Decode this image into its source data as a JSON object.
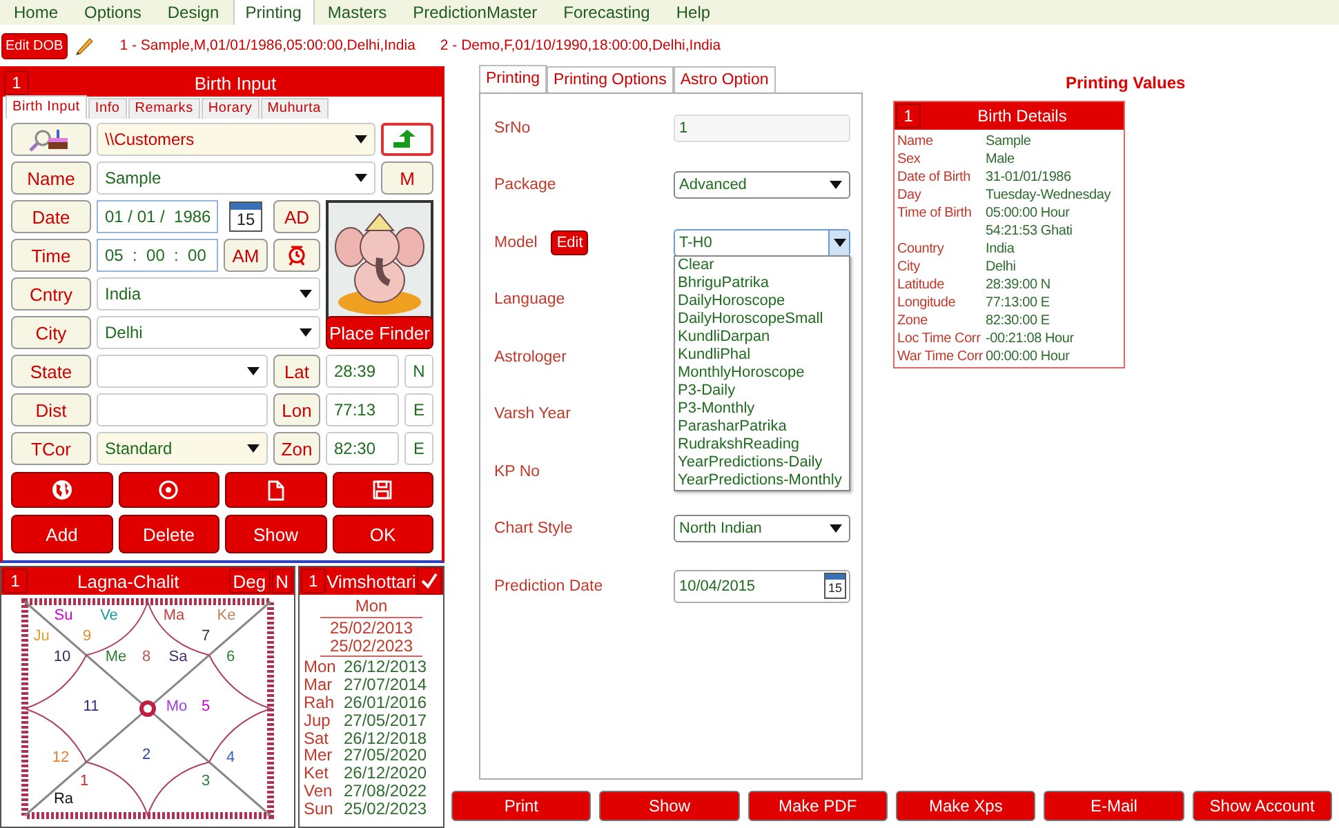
{
  "menu": [
    {
      "label": "Home",
      "selected": false
    },
    {
      "label": "Options",
      "selected": false
    },
    {
      "label": "Design",
      "selected": false
    },
    {
      "label": "Printing",
      "selected": true
    },
    {
      "label": "Masters",
      "selected": false
    },
    {
      "label": "PredictionMaster",
      "selected": false
    },
    {
      "label": "Forecasting",
      "selected": false
    },
    {
      "label": "Help",
      "selected": false
    }
  ],
  "edit_dob_button": "Edit DOB",
  "recent_records": [
    "1 - Sample,M,01/01/1986,05:00:00,Delhi,India",
    "2 - Demo,F,01/10/1990,18:00:00,Delhi,India"
  ],
  "birth_input": {
    "number": "1",
    "title": "Birth Input",
    "tabs": [
      {
        "label": "Birth Input",
        "selected": true
      },
      {
        "label": "Info",
        "selected": false
      },
      {
        "label": "Remarks",
        "selected": false
      },
      {
        "label": "Horary",
        "selected": false
      },
      {
        "label": "Muhurta",
        "selected": false
      }
    ],
    "folder": "\\\\Customers",
    "name_label": "Name",
    "name": "Sample",
    "sex": "M",
    "date_label": "Date",
    "date": "01 / 01 /  1986",
    "calendar_day": "15",
    "era": "AD",
    "time_label": "Time",
    "time": "05  :  00  :  00",
    "meridiem": "AM",
    "country_label": "Cntry",
    "country": "India",
    "city_label": "City",
    "city": "Delhi",
    "place_finder": "Place Finder",
    "state_label": "State",
    "lat_label": "Lat",
    "lat": "28:39",
    "lat_dir": "N",
    "dist_label": "Dist",
    "lon_label": "Lon",
    "lon": "77:13",
    "lon_dir": "E",
    "tcor_label": "TCor",
    "tcor": "Standard",
    "zon_label": "Zon",
    "zon": "82:30",
    "zon_dir": "E",
    "actions": [
      "Add",
      "Delete",
      "Show",
      "OK"
    ]
  },
  "lagna_chart": {
    "number": "1",
    "title": "Lagna-Chalit",
    "deg_button": "Deg",
    "n_button": "N",
    "houses": [
      {
        "sign": "9",
        "color": "#e09030",
        "planets": [
          {
            "name": "Su",
            "color": "#cc00cc"
          },
          {
            "name": "Ve",
            "color": "#1a9a9a"
          }
        ]
      },
      {
        "sign": "7",
        "color": "#333333",
        "planets": [
          {
            "name": "Ma",
            "color": "#c04040"
          },
          {
            "name": "Ke",
            "color": "#c08060"
          }
        ]
      },
      {
        "sign": "10",
        "color": "#303060",
        "planets": [
          {
            "name": "Ju",
            "color": "#e0a030"
          }
        ]
      },
      {
        "sign": "8",
        "color": "#c0504d",
        "planets": [
          {
            "name": "Me",
            "color": "#2e7d32"
          },
          {
            "name": "Sa",
            "color": "#4a2a6a"
          }
        ]
      },
      {
        "sign": "6",
        "color": "#2e7d32"
      },
      {
        "sign": "11",
        "color": "#303080"
      },
      {
        "sign": "5",
        "color": "#cc00cc",
        "planets": [
          {
            "name": "Mo",
            "color": "#a040e0"
          }
        ]
      },
      {
        "sign": "12",
        "color": "#e08030"
      },
      {
        "sign": "2",
        "color": "#3040a0"
      },
      {
        "sign": "4",
        "color": "#3060c0"
      },
      {
        "sign": "1",
        "color": "#c03030",
        "planets": [
          {
            "name": "Ra",
            "color": "#111111"
          }
        ]
      },
      {
        "sign": "3",
        "color": "#2e7d32"
      }
    ]
  },
  "vimshottari": {
    "number": "1",
    "title": "Vimshottari",
    "current_lord": "Mon",
    "start": "25/02/2013",
    "end": "25/02/2023",
    "periods": [
      {
        "lord": "Mon",
        "date": "26/12/2013"
      },
      {
        "lord": "Mar",
        "date": "27/07/2014"
      },
      {
        "lord": "Rah",
        "date": "26/01/2016"
      },
      {
        "lord": "Jup",
        "date": "27/05/2017"
      },
      {
        "lord": "Sat",
        "date": "26/12/2018"
      },
      {
        "lord": "Mer",
        "date": "27/05/2020"
      },
      {
        "lord": "Ket",
        "date": "26/12/2020"
      },
      {
        "lord": "Ven",
        "date": "27/08/2022"
      },
      {
        "lord": "Sun",
        "date": "25/02/2023"
      }
    ]
  },
  "printing_form": {
    "tabs": [
      {
        "label": "Printing",
        "selected": true
      },
      {
        "label": "Printing Options",
        "selected": false
      },
      {
        "label": "Astro Option",
        "selected": false
      }
    ],
    "fields": [
      {
        "label": "SrNo",
        "kind": "text",
        "value": "1"
      },
      {
        "label": "Package",
        "kind": "select",
        "value": "Advanced"
      },
      {
        "label": "Model",
        "kind": "select",
        "value": "T-H0",
        "edit_button": "Edit",
        "expanded": true,
        "options": [
          "Clear",
          "BhriguPatrika",
          "DailyHoroscope",
          "DailyHoroscopeSmall",
          "KundliDarpan",
          "KundliPhal",
          "MonthlyHoroscope",
          "P3-Daily",
          "P3-Monthly",
          "ParasharPatrika",
          "RudrakshReading",
          "YearPredictions-Daily",
          "YearPredictions-Monthly"
        ]
      },
      {
        "label": "Language",
        "kind": "covered"
      },
      {
        "label": "Astrologer",
        "kind": "covered"
      },
      {
        "label": "Varsh Year",
        "kind": "covered"
      },
      {
        "label": "KP No",
        "kind": "covered"
      },
      {
        "label": "Chart Style",
        "kind": "select",
        "value": "North Indian"
      },
      {
        "label": "Prediction Date",
        "kind": "date",
        "value": "10/04/2015",
        "calendar_day": "15"
      }
    ]
  },
  "printing_values": {
    "title": "Printing Values",
    "card": {
      "number": "1",
      "title": "Birth Details",
      "rows": [
        {
          "label": "Name",
          "value": "Sample"
        },
        {
          "label": "Sex",
          "value": "Male"
        },
        {
          "label": "Date of Birth",
          "value": "31-01/01/1986"
        },
        {
          "label": "Day",
          "value": "Tuesday-Wednesday"
        },
        {
          "label": "Time of Birth",
          "value": "05:00:00 Hour"
        },
        {
          "value": "54:21:53 Ghati"
        },
        {
          "label": "Country",
          "value": "India"
        },
        {
          "label": "City",
          "value": "Delhi"
        },
        {
          "label": "Latitude",
          "value": "28:39:00 N"
        },
        {
          "label": "Longitude",
          "value": "77:13:00 E"
        },
        {
          "label": "Zone",
          "value": "82:30:00 E"
        },
        {
          "label": "Loc Time Corr",
          "value": "-00:21:08 Hour"
        },
        {
          "label": "War Time Corr",
          "value": "00:00:00 Hour"
        }
      ]
    }
  },
  "bottom_buttons": [
    "Print",
    "Show",
    "Make PDF",
    "Make Xps",
    "E-Mail",
    "Show Account"
  ]
}
